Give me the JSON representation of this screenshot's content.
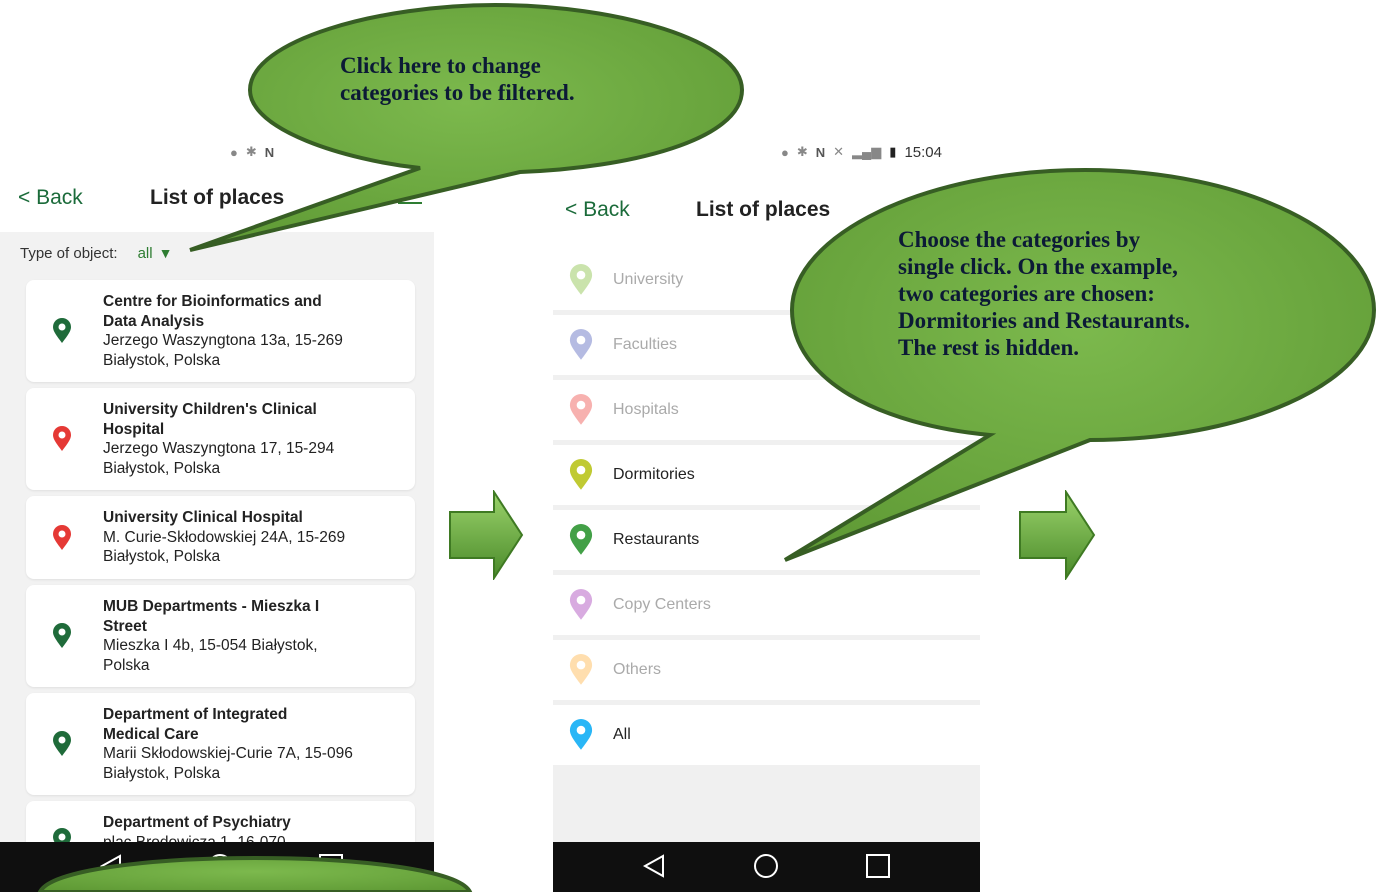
{
  "phone1": {
    "status_icons": [
      "location-icon",
      "bluetooth-icon",
      "nfc-icon"
    ],
    "back_label": "< Back",
    "title": "List of places",
    "filter_label": "Type of object:",
    "filter_value": "all",
    "places": [
      {
        "name_1": "Centre for Bioinformatics and",
        "name_2": "Data Analysis",
        "addr_1": "Jerzego Waszyngtona 13a, 15-269",
        "addr_2": "Białystok, Polska",
        "color": "#1f6b3a",
        "icon": "leaf-icon"
      },
      {
        "name_1": "University Children's Clinical",
        "name_2": "Hospital",
        "addr_1": "Jerzego Waszyngtona 17, 15-294",
        "addr_2": "Białystok, Polska",
        "color": "#e53935",
        "icon": "hospital-icon"
      },
      {
        "name_1": "University Clinical Hospital",
        "name_2": "",
        "addr_1": "M. Curie-Skłodowskiej 24A, 15-269",
        "addr_2": "Białystok, Polska",
        "color": "#e53935",
        "icon": "hospital-icon"
      },
      {
        "name_1": "MUB Departments - Mieszka I",
        "name_2": "Street",
        "addr_1": "Mieszka I 4b, 15-054 Białystok,",
        "addr_2": "Polska",
        "color": "#1f6b3a",
        "icon": "leaf-icon"
      },
      {
        "name_1": "Department of Integrated",
        "name_2": "Medical Care",
        "addr_1": "Marii Skłodowskiej-Curie 7A, 15-096",
        "addr_2": "Białystok, Polska",
        "color": "#1f6b3a",
        "icon": "leaf-icon"
      },
      {
        "name_1": "Department of Psychiatry",
        "name_2": "",
        "addr_1": "plac Brodowicza 1, 16-070",
        "addr_2": "",
        "color": "#1f6b3a",
        "icon": "leaf-icon"
      }
    ]
  },
  "phone2": {
    "status_time": "15:04",
    "back_label": "< Back",
    "title": "List of places",
    "categories": [
      {
        "label": "University",
        "color": "#8bc34a",
        "state": "off",
        "icon": "university-icon"
      },
      {
        "label": "Faculties",
        "color": "#5c6bc0",
        "state": "off",
        "icon": "faculties-icon"
      },
      {
        "label": "Hospitals",
        "color": "#ef5350",
        "state": "off",
        "icon": "hospital-icon"
      },
      {
        "label": "Dormitories",
        "color": "#c0ca33",
        "state": "on",
        "icon": "bed-icon"
      },
      {
        "label": "Restaurants",
        "color": "#43a047",
        "state": "on",
        "icon": "restaurant-icon"
      },
      {
        "label": "Copy Centers",
        "color": "#ab47bc",
        "state": "off",
        "icon": "printer-icon"
      },
      {
        "label": "Others",
        "color": "#ffb74d",
        "state": "off",
        "icon": "dots-icon"
      },
      {
        "label": "All",
        "color": "#29b6f6",
        "state": "on",
        "icon": "grid-icon"
      }
    ]
  },
  "callouts": {
    "top_lines": [
      "Click here to change",
      "categories to be filtered."
    ],
    "right_lines": [
      "Choose the categories by",
      "single click. On the example,",
      "two categories are chosen:",
      "Dormitories and Restaurants.",
      "The rest is hidden."
    ]
  },
  "colors": {
    "callout_fill": "#71ac45",
    "callout_stroke": "#375e24",
    "accent": "#2e7d32",
    "arrow": "#6ab04c"
  }
}
